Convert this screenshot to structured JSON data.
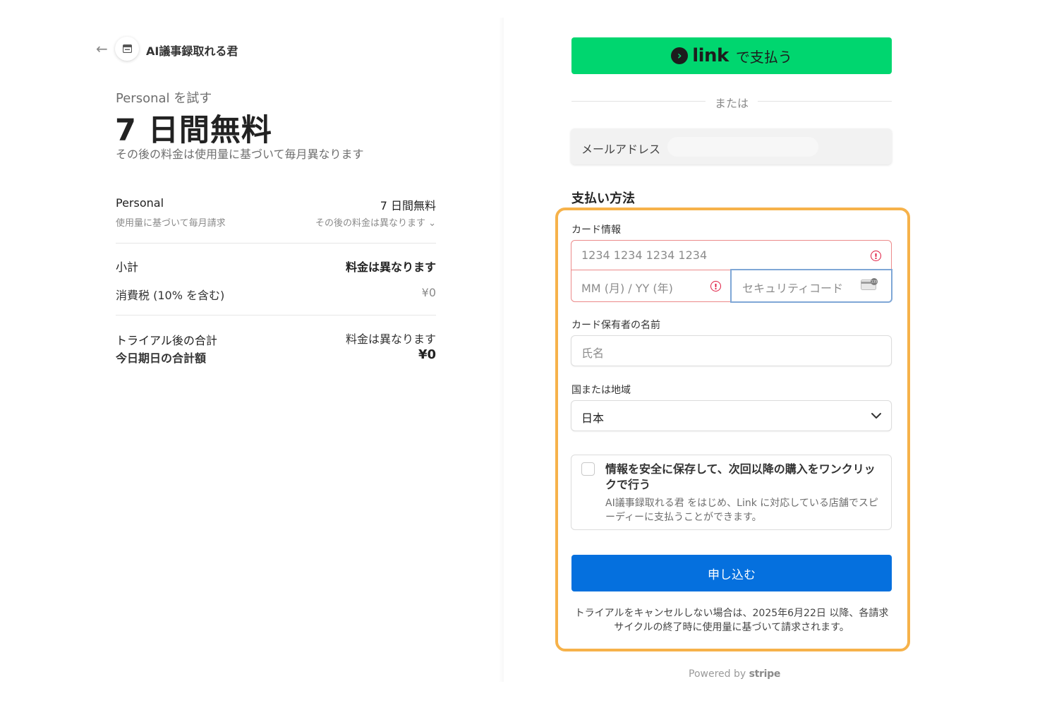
{
  "nav": {
    "back_icon": "arrow-left-icon",
    "brand_name": "AI議事録取れる君"
  },
  "summary": {
    "try_label": "Personal を試す",
    "headline": "7 日間無料",
    "headline_sub": "その後の料金は使用量に基づいて毎月異なります",
    "plan_name": "Personal",
    "plan_sub": "使用量に基づいて毎月請求",
    "plan_price": "7 日間無料",
    "plan_price_sub": "その後の料金は異なります ⌄",
    "subtotal_label": "小計",
    "subtotal_value": "料金は異なります",
    "tax_label": "消費税 (10% を含む)",
    "tax_value": "¥0",
    "after_trial_label": "トライアル後の合計",
    "after_trial_value": "料金は異なります",
    "today_label": "今日期日の合計額",
    "today_value": "¥0"
  },
  "payment": {
    "link_button": {
      "word": "link",
      "rest": "で支払う",
      "color": "#00d66f"
    },
    "or_text": "または",
    "email_label": "メールアドレス",
    "method_title": "支払い方法",
    "card_info_label": "カード情報",
    "card_number_placeholder": "1234 1234 1234 1234",
    "expiry_placeholder": "MM (月) / YY (年)",
    "cvc_placeholder": "セキュリティコード",
    "holder_label": "カード保有者の名前",
    "holder_placeholder": "氏名",
    "country_label": "国または地域",
    "country_value": "日本",
    "save_title": "情報を安全に保存して、次回以降の購入をワンクリックで行う",
    "save_desc": "AI議事録取れる君 をはじめ、Link に対応している店舗でスピーディーに支払うことができます。",
    "submit_label": "申し込む",
    "submit_color": "#0570de",
    "notice": "トライアルをキャンセルしない場合は、2025年6月22日 以降、各請求サイクルの終了時に使用量に基づいて請求されます。",
    "error_color": "#df1b41",
    "highlight_color": "#f6b24a"
  },
  "footer": {
    "powered_by": "Powered by",
    "stripe": "stripe"
  }
}
